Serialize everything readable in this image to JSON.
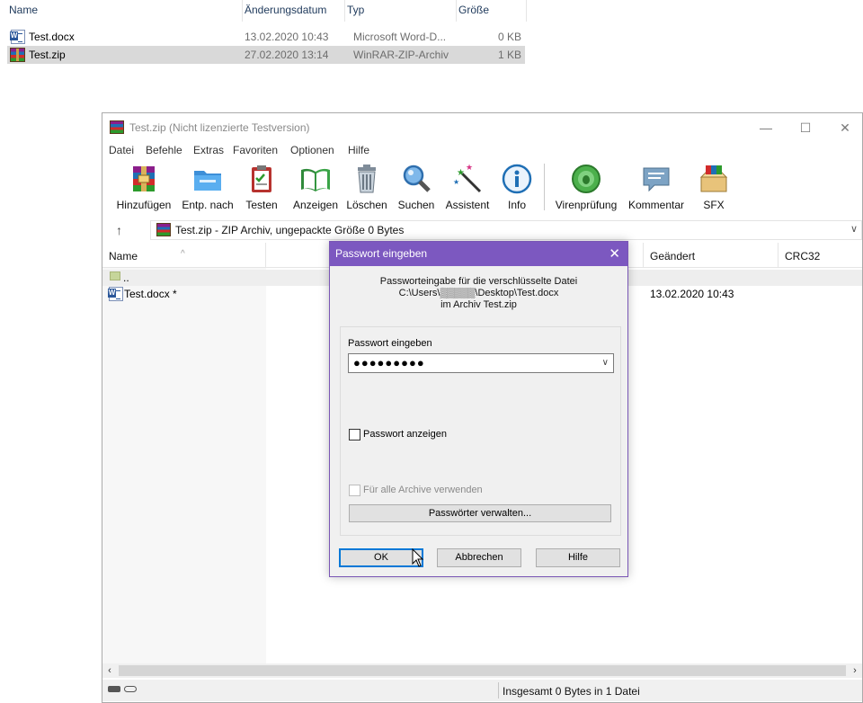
{
  "explorer": {
    "headers": {
      "name": "Name",
      "date": "Änderungsdatum",
      "type": "Typ",
      "size": "Größe"
    },
    "files": [
      {
        "name": "Test.docx",
        "date": "13.02.2020 10:43",
        "type": "Microsoft Word-D...",
        "size": "0 KB",
        "icon": "word-doc-icon"
      },
      {
        "name": "Test.zip",
        "date": "27.02.2020 13:14",
        "type": "WinRAR-ZIP-Archiv",
        "size": "1 KB",
        "icon": "winrar-archive-icon",
        "selected": true
      }
    ]
  },
  "winrar": {
    "title": "Test.zip (Nicht lizenzierte Testversion)",
    "window_buttons": {
      "minimize": "—",
      "maximize": "☐",
      "close": "✕"
    },
    "menu": [
      "Datei",
      "Befehle",
      "Extras",
      "Favoriten",
      "Optionen",
      "Hilfe"
    ],
    "toolbar": [
      {
        "label": "Hinzufügen",
        "icon": "add-archive-icon"
      },
      {
        "label": "Entp. nach",
        "icon": "extract-folder-icon"
      },
      {
        "label": "Testen",
        "icon": "test-clipboard-icon"
      },
      {
        "label": "Anzeigen",
        "icon": "view-book-icon"
      },
      {
        "label": "Löschen",
        "icon": "trash-icon"
      },
      {
        "label": "Suchen",
        "icon": "magnifier-icon"
      },
      {
        "label": "Assistent",
        "icon": "wizard-wand-icon"
      },
      {
        "label": "Info",
        "icon": "info-icon"
      },
      {
        "label": "Virenprüfung",
        "icon": "virus-scan-icon"
      },
      {
        "label": "Kommentar",
        "icon": "comment-icon"
      },
      {
        "label": "SFX",
        "icon": "sfx-box-icon"
      }
    ],
    "address": "Test.zip - ZIP Archiv, ungepackte Größe 0 Bytes",
    "columns": {
      "name": "Name",
      "modified": "Geändert",
      "crc": "CRC32"
    },
    "rows": [
      {
        "name": "..",
        "modified": ""
      },
      {
        "name": "Test.docx *",
        "modified": "13.02.2020 10:43"
      }
    ],
    "status": "Insgesamt 0 Bytes in 1 Datei"
  },
  "dialog": {
    "title": "Passwort eingeben",
    "info_lines": [
      "Passworteingabe für die verschlüsselte Datei",
      "C:\\Users\\▒▒▒▒▒\\Desktop\\Test.docx",
      "im Archiv Test.zip"
    ],
    "password_label": "Passwort eingeben",
    "password_value": "●●●●●●●●●",
    "show_password": {
      "label": "Passwort anzeigen",
      "checked": false
    },
    "all_archives": {
      "label": "Für alle Archive verwenden",
      "checked": false,
      "disabled": true
    },
    "manage_button": "Passwörter verwalten...",
    "buttons": {
      "ok": "OK",
      "cancel": "Abbrechen",
      "help": "Hilfe"
    }
  }
}
